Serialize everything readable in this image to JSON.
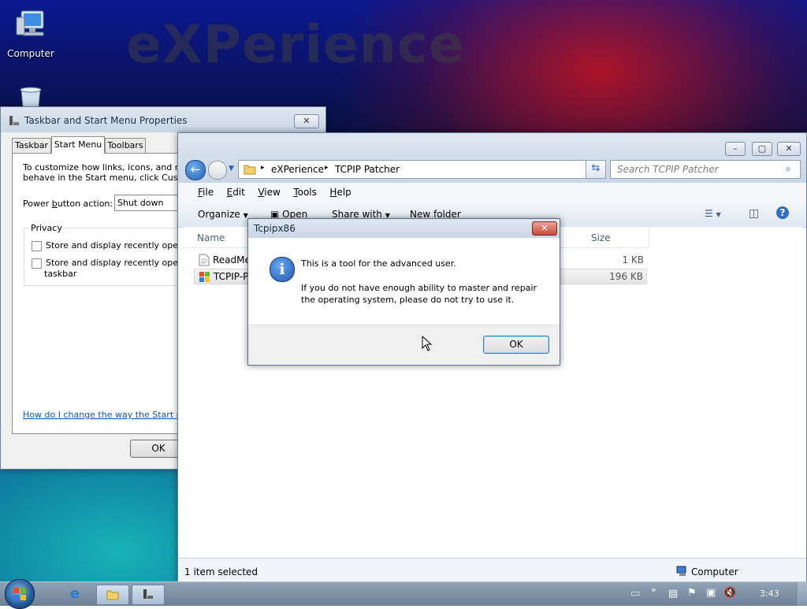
{
  "desktop": {
    "watermark": "eXPerience",
    "icons": [
      {
        "label": "Computer",
        "icon": "computer-icon"
      },
      {
        "label": "",
        "icon": "recycle-bin-icon"
      }
    ]
  },
  "taskbar_props": {
    "title": "Taskbar and Start Menu Properties",
    "tabs": [
      "Taskbar",
      "Start Menu",
      "Toolbars"
    ],
    "active_tab": "Start Menu",
    "desc": "To customize how links, icons, and menus look and",
    "desc2": "behave in the Start menu, click Customize",
    "power_label_pre": "Power ",
    "power_label_u": "b",
    "power_label_post": "utton action:",
    "power_value": "Shut down",
    "privacy_label": "Privacy",
    "privacy_opt1": "Store and display recently opened p",
    "privacy_opt2a": "Store and display recently opened i",
    "privacy_opt2b": "taskbar",
    "help_link": "How do I change the way the Start menu",
    "ok": "OK"
  },
  "explorer": {
    "breadcrumb": [
      "eXPerience",
      "TCPIP Patcher"
    ],
    "search_placeholder": "Search TCPIP Patcher",
    "menu": [
      {
        "u": "F",
        "rest": "ile"
      },
      {
        "u": "E",
        "rest": "dit"
      },
      {
        "u": "V",
        "rest": "iew"
      },
      {
        "u": "T",
        "rest": "ools"
      },
      {
        "u": "H",
        "rest": "elp"
      }
    ],
    "toolbar": {
      "organize": "Organize",
      "open": "Open",
      "share": "Share with",
      "new_folder": "New folder"
    },
    "columns": {
      "name": "Name",
      "size": "Size"
    },
    "files": [
      {
        "name": "ReadMe",
        "size": "1 KB",
        "icon": "text-file-icon"
      },
      {
        "name": "TCPIP-P",
        "size": "196 KB",
        "icon": "app-icon"
      }
    ],
    "status_left": "1 item selected",
    "status_right": "Computer"
  },
  "dialog": {
    "title": "Tcpipx86",
    "line1": "This is a tool for the advanced user.",
    "line2": "If you do not have enough ability to master and repair",
    "line3": "the operating system, please do not try to use it.",
    "ok": "OK"
  },
  "taskbar": {
    "clock": "3:43"
  },
  "colors": {
    "accent": "#1f5fb5",
    "close_red": "#c94a3a"
  }
}
